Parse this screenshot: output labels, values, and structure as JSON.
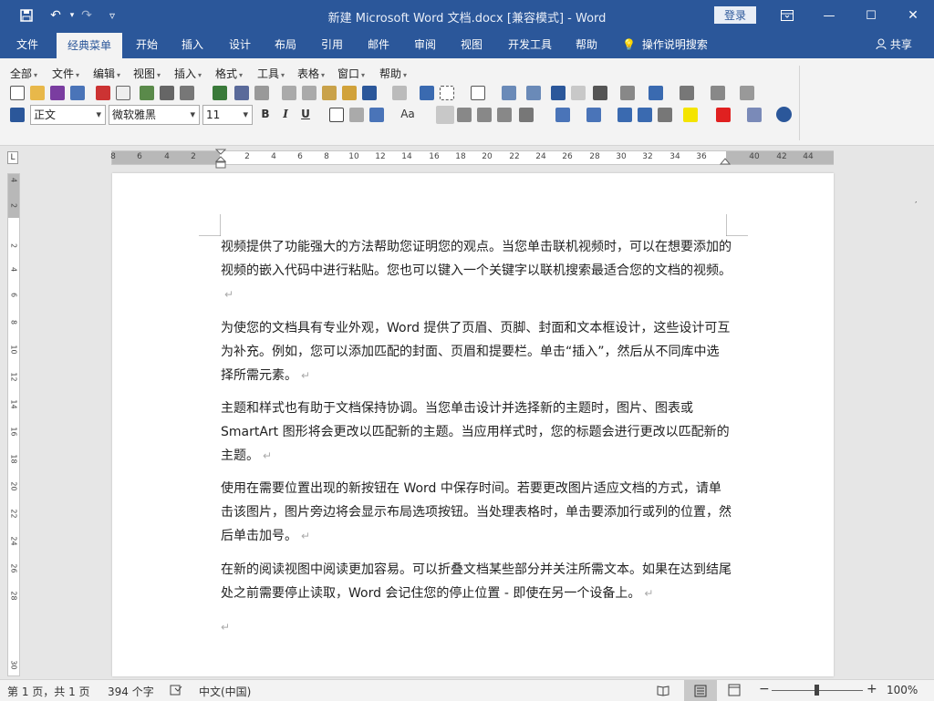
{
  "titlebar": {
    "title": "新建 Microsoft Word 文档.docx [兼容模式]  -  Word",
    "login": "登录",
    "minimize": "—",
    "restore": "☐",
    "close": "✕",
    "save_icon": "💾",
    "undo": "↶",
    "redo": "↷",
    "customize": "▿"
  },
  "tabs": [
    "文件",
    "经典菜单",
    "开始",
    "插入",
    "设计",
    "布局",
    "引用",
    "邮件",
    "审阅",
    "视图",
    "开发工具",
    "帮助"
  ],
  "search": {
    "label": "操作说明搜索"
  },
  "share": {
    "label": "共享"
  },
  "menubar": [
    "全部",
    "文件",
    "编辑",
    "视图",
    "插入",
    "格式",
    "工具",
    "表格",
    "窗口",
    "帮助"
  ],
  "format": {
    "style": "正文",
    "font": "微软雅黑",
    "size": "11",
    "bold": "B",
    "italic": "I",
    "underline": "U",
    "aa": "Aa"
  },
  "ruler": {
    "labels": [
      "8",
      "6",
      "4",
      "2",
      "2",
      "4",
      "6",
      "8",
      "10",
      "12",
      "14",
      "16",
      "18",
      "20",
      "22",
      "24",
      "26",
      "28",
      "30",
      "32",
      "34",
      "36",
      "40",
      "42",
      "44"
    ],
    "vlabels": [
      "4",
      "2",
      "2",
      "4",
      "6",
      "8",
      "10",
      "12",
      "14",
      "16",
      "18",
      "20",
      "22",
      "24",
      "26",
      "28",
      "30"
    ],
    "corner": "L"
  },
  "document": {
    "paragraphs": [
      "视频提供了功能强大的方法帮助您证明您的观点。当您单击联机视频时，可以在想要添加的视频的嵌入代码中进行粘贴。您也可以键入一个关键字以联机搜索最适合您的文档的视频。",
      "为使您的文档具有专业外观，Word 提供了页眉、页脚、封面和文本框设计，这些设计可互为补充。例如，您可以添加匹配的封面、页眉和提要栏。单击“插入”，然后从不同库中选择所需元素。",
      "主题和样式也有助于文档保持协调。当您单击设计并选择新的主题时，图片、图表或 SmartArt 图形将会更改以匹配新的主题。当应用样式时，您的标题会进行更改以匹配新的主题。",
      "使用在需要位置出现的新按钮在 Word 中保存时间。若要更改图片适应文档的方式，请单击该图片，图片旁边将会显示布局选项按钮。当处理表格时，单击要添加行或列的位置，然后单击加号。",
      "在新的阅读视图中阅读更加容易。可以折叠文档某些部分并关注所需文本。如果在达到结尾处之前需要停止读取，Word 会记住您的停止位置 - 即使在另一个设备上。"
    ],
    "para_mark": "↵"
  },
  "statusbar": {
    "page": "第 1 页，共 1 页",
    "words": "394 个字",
    "language": "中文(中国)",
    "zoom": "100%",
    "zoom_minus": "−",
    "zoom_plus": "+"
  }
}
